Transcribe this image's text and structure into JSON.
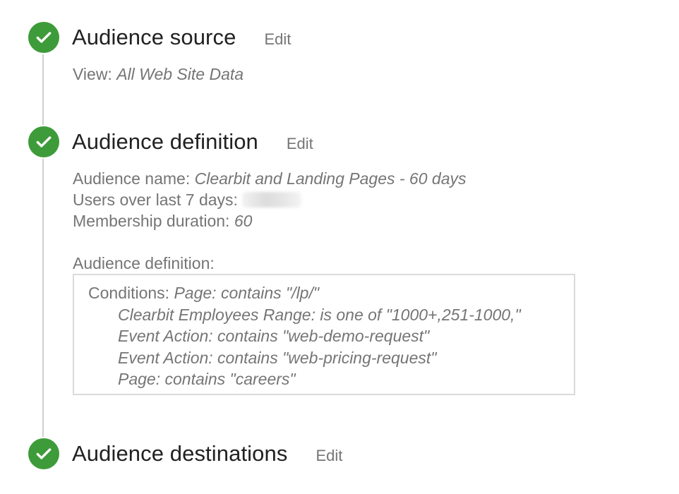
{
  "steps": [
    {
      "title": "Audience source",
      "edit_label": "Edit"
    },
    {
      "title": "Audience definition",
      "edit_label": "Edit"
    },
    {
      "title": "Audience destinations",
      "edit_label": "Edit"
    }
  ],
  "source": {
    "view_label": "View:",
    "view_value": "All Web Site Data"
  },
  "definition": {
    "name_label": "Audience name:",
    "name_value": "Clearbit and Landing Pages - 60 days",
    "users_label": "Users over last 7 days:",
    "duration_label": "Membership duration:",
    "duration_value": "60",
    "definition_label": "Audience definition:",
    "conditions_label": "Conditions:",
    "conditions": [
      "Page: contains \"/lp/\"",
      "Clearbit Employees Range: is one of \"1000+,251-1000,\"",
      "Event Action: contains \"web-demo-request\"",
      "Event Action: contains \"web-pricing-request\"",
      "Page: contains \"careers\""
    ]
  },
  "colors": {
    "check_green": "#3e9b3a",
    "timeline_gray": "#cfcfcf",
    "title_text": "#212121",
    "secondary_text": "#757575"
  },
  "icons": {
    "step_status": "check-circle-icon"
  }
}
